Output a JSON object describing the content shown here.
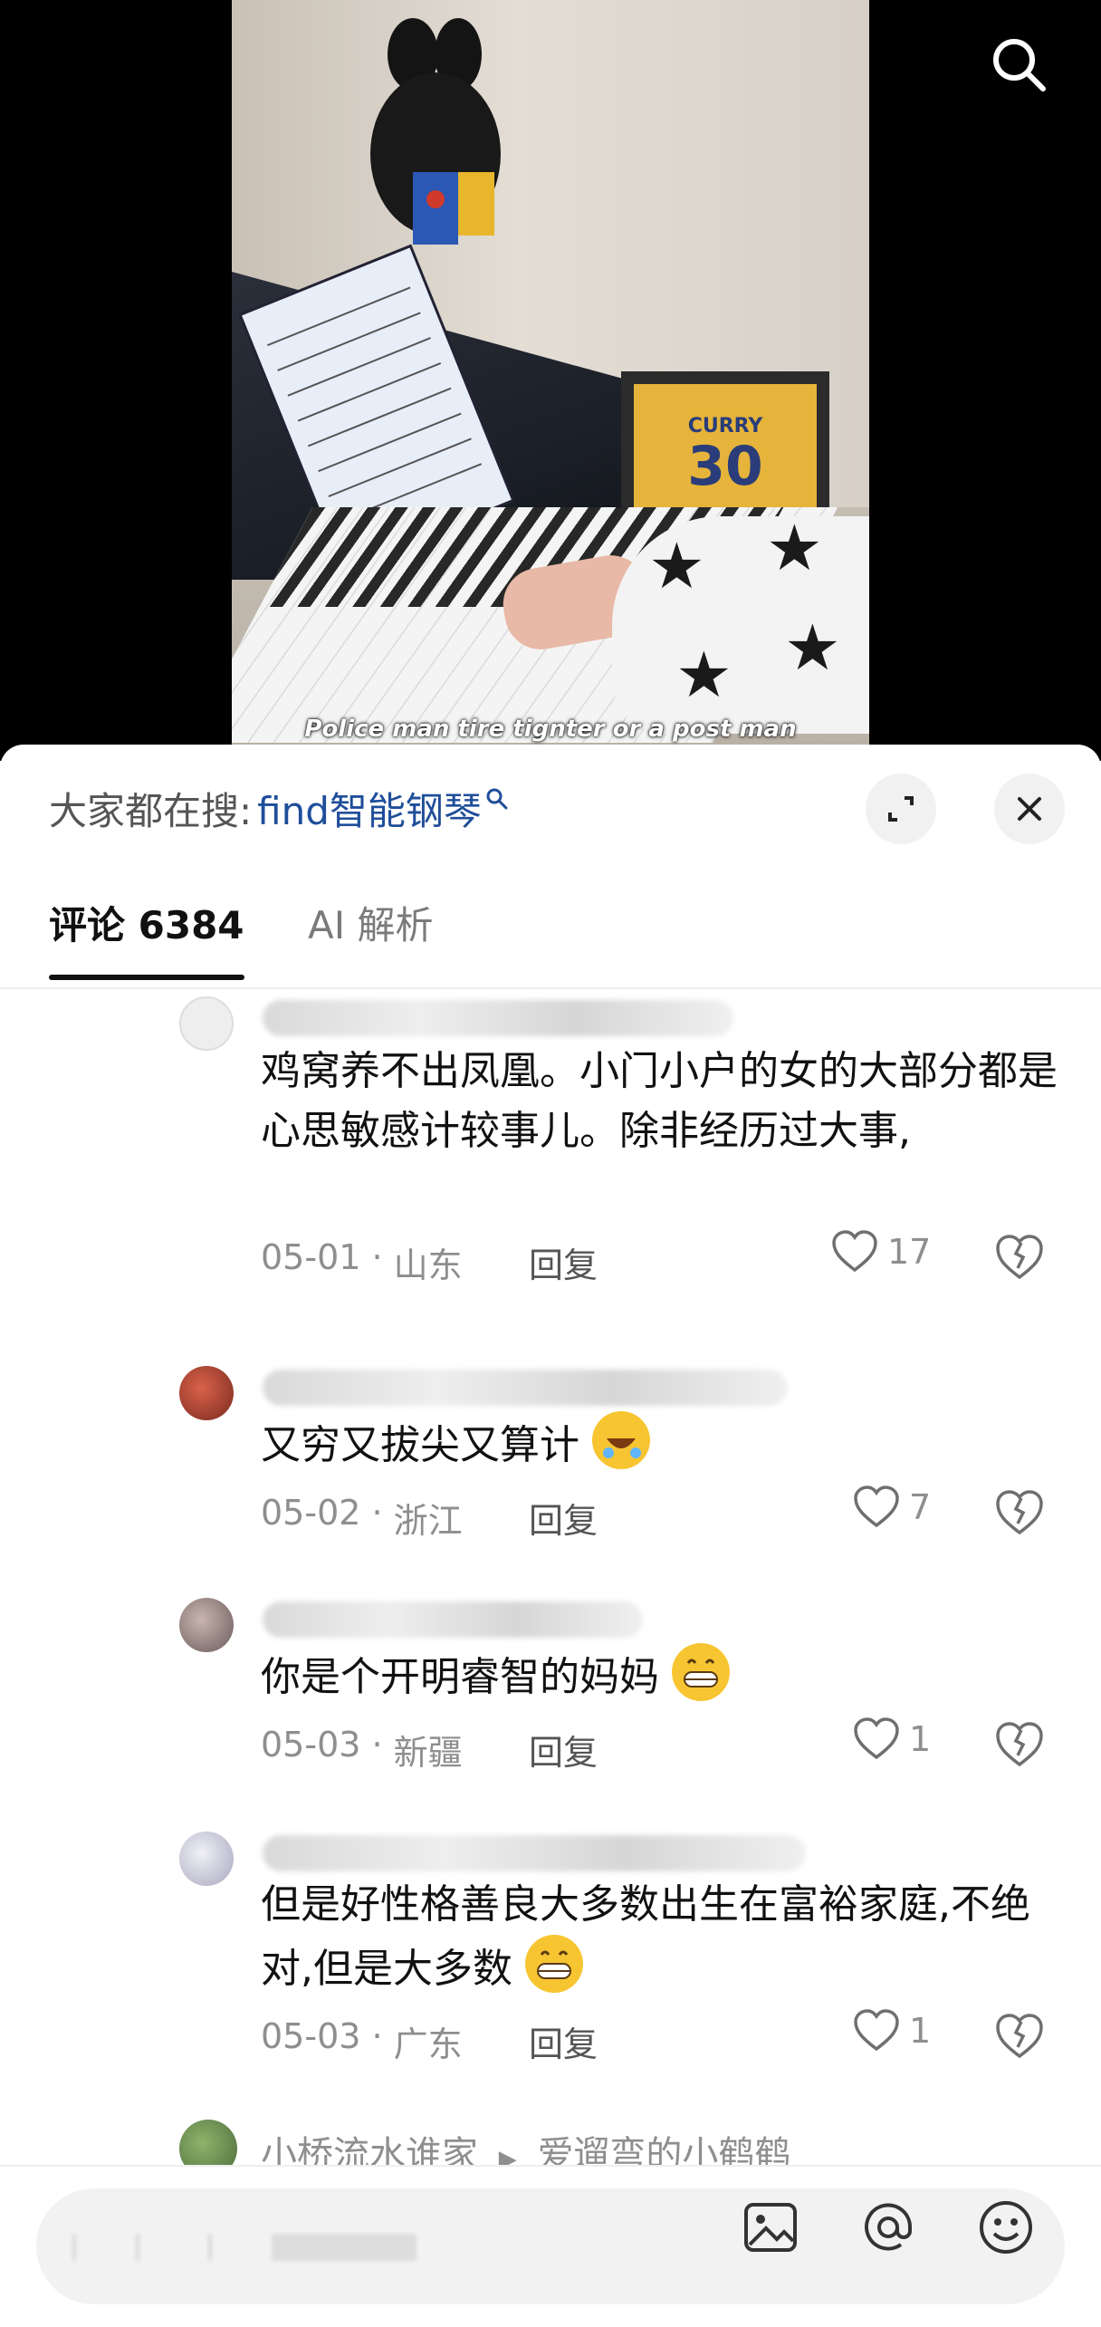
{
  "video": {
    "subtitle": "Police man tire tignter or a post man",
    "jersey_name": "CURRY",
    "jersey_number": "30"
  },
  "sheet": {
    "search_prefix": "大家都在搜:",
    "search_term": "find智能钢琴"
  },
  "tabs": {
    "comments_label": "评论 6384",
    "ai_label": "AI 解析"
  },
  "comments": [
    {
      "text": "鸡窝养不出凤凰。小门小户的女的大部分都是心思敏感计较事儿。除非经历过大事,",
      "date": "05-01",
      "location": "山东",
      "reply_label": "回复",
      "likes": "17"
    },
    {
      "text": "又穷又拔尖又算计",
      "date": "05-02",
      "location": "浙江",
      "reply_label": "回复",
      "likes": "7"
    },
    {
      "text": "你是个开明睿智的妈妈",
      "date": "05-03",
      "location": "新疆",
      "reply_label": "回复",
      "likes": "1"
    },
    {
      "text": "但是好性格善良大多数出生在富裕家庭,不绝对,但是大多数",
      "date": "05-03",
      "location": "广东",
      "reply_label": "回复",
      "likes": "1"
    }
  ],
  "reply_preview": {
    "from": "小桥流水谁家",
    "to": "爱遛弯的小鹤鹤"
  },
  "icons": {
    "search": "search-icon",
    "expand": "expand-icon",
    "close": "close-icon",
    "heart": "heart-icon",
    "dislike": "broken-heart-icon",
    "image": "image-icon",
    "mention": "at-icon",
    "emoji": "emoji-icon"
  }
}
